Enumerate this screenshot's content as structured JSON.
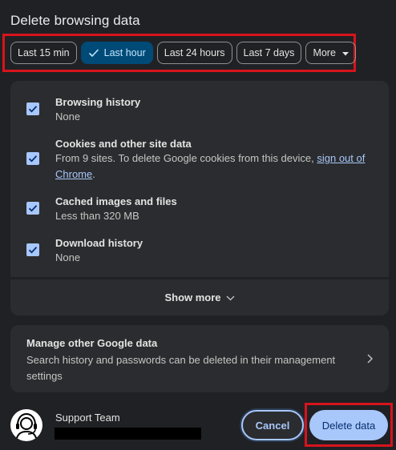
{
  "dialog": {
    "title": "Delete browsing data"
  },
  "time_range": {
    "chips": [
      {
        "label": "Last 15 min",
        "selected": false
      },
      {
        "label": "Last hour",
        "selected": true
      },
      {
        "label": "Last 24 hours",
        "selected": false
      },
      {
        "label": "Last 7 days",
        "selected": false
      },
      {
        "label": "More",
        "selected": false
      }
    ]
  },
  "items": [
    {
      "title": "Browsing history",
      "subtitle": "None",
      "checked": true
    },
    {
      "title": "Cookies and other site data",
      "subtitle_prefix": "From 9 sites. To delete Google cookies from this device, ",
      "subtitle_link": "sign out of Chrome",
      "subtitle_suffix": ".",
      "checked": true
    },
    {
      "title": "Cached images and files",
      "subtitle": "Less than 320 MB",
      "checked": true
    },
    {
      "title": "Download history",
      "subtitle": "None",
      "checked": true
    }
  ],
  "show_more_label": "Show more",
  "manage": {
    "title": "Manage other Google data",
    "subtitle": "Search history and passwords can be deleted in their management settings"
  },
  "account": {
    "name": "Support Team"
  },
  "buttons": {
    "cancel": "Cancel",
    "delete": "Delete data"
  },
  "colors": {
    "background": "#202124",
    "card": "#2b2c2f",
    "accent": "#a8c7fa",
    "selected_chip": "#004a77",
    "highlight": "#d7141c"
  }
}
